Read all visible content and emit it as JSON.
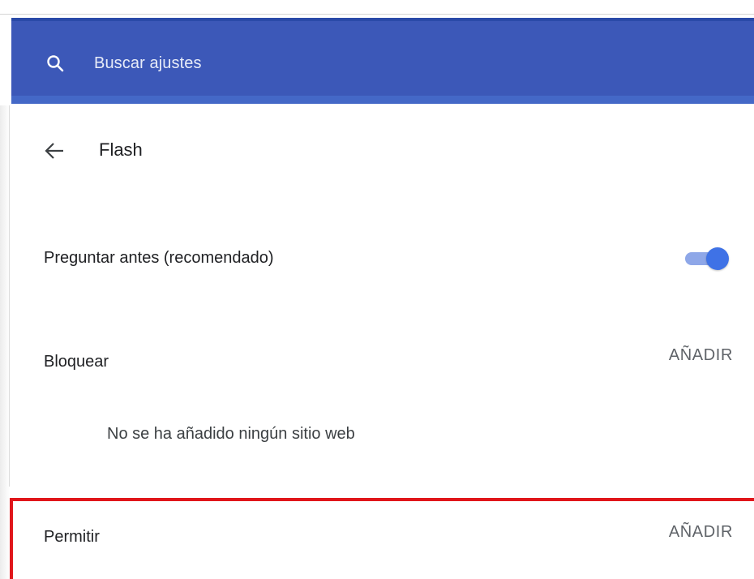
{
  "search": {
    "placeholder": "Buscar ajustes"
  },
  "subpage": {
    "title": "Flash"
  },
  "ask_first": {
    "label": "Preguntar antes (recomendado)",
    "enabled": true
  },
  "block": {
    "label": "Bloquear",
    "add_label": "AÑADIR",
    "empty_text": "No se ha añadido ningún sitio web"
  },
  "allow": {
    "label": "Permitir",
    "add_label": "AÑADIR"
  },
  "colors": {
    "header": "#3c58b8",
    "toggle_on": "#3f72e6",
    "highlight": "#e0161b"
  }
}
